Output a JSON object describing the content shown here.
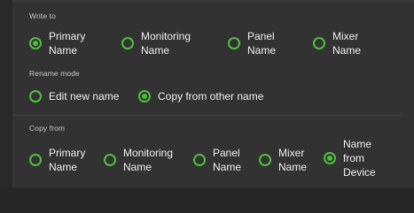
{
  "write_to": {
    "caption": "Write to",
    "options": [
      {
        "label": "Primary\nName",
        "checked": true
      },
      {
        "label": "Monitoring\nName",
        "checked": false
      },
      {
        "label": "Panel\nName",
        "checked": false
      },
      {
        "label": "Mixer\nName",
        "checked": false
      }
    ]
  },
  "rename_mode": {
    "caption": "Rename mode",
    "options": [
      {
        "label": "Edit new name",
        "checked": false
      },
      {
        "label": "Copy from other name",
        "checked": true
      }
    ]
  },
  "copy_from": {
    "caption": "Copy from",
    "options": [
      {
        "label": "Primary\nName",
        "checked": false
      },
      {
        "label": "Monitoring\nName",
        "checked": false
      },
      {
        "label": "Panel\nName",
        "checked": false
      },
      {
        "label": "Mixer\nName",
        "checked": false
      },
      {
        "label": "Name\nfrom\nDevice",
        "checked": true
      }
    ]
  },
  "colors": {
    "accent": "#4fbf3e",
    "background": "#323232",
    "text": "#efefef",
    "caption_text": "#c8c8c8"
  }
}
